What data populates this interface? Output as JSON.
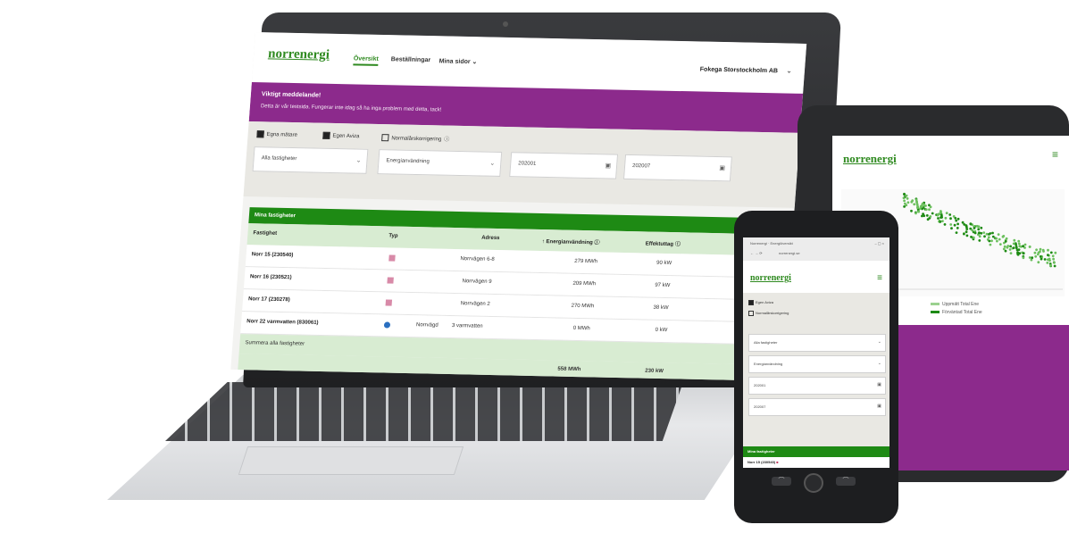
{
  "brand": {
    "logo": "norrenergi",
    "accent": "#1e8a14",
    "purple": "#8c2a8c"
  },
  "laptop": {
    "nav": {
      "items": [
        {
          "label": "Översikt",
          "active": true
        },
        {
          "label": "Beställningar",
          "active": false
        },
        {
          "label": "Mina sidor ⌄",
          "active": false
        }
      ],
      "org": "Fokega Storstockholm AB"
    },
    "banner": {
      "title": "Viktigt meddelande!",
      "text": "Detta är vår testsida. Fungerar inte idag så ha inga problem med detta, tack!"
    },
    "filters": {
      "checkbox_own_meter": "Egna mätare",
      "checkbox_own_fuel": "Egen Aviza",
      "checkbox_normal_year": "Normalårskorrigering",
      "select_properties": "Alla fastigheter",
      "select_metric": "Energianvändning",
      "date_from": "202001",
      "date_to": "202007"
    },
    "table": {
      "title": "Mina fastigheter",
      "columns": [
        "Fastighet",
        "Typ",
        "Adress",
        "Energianvändning",
        "Effektuttag"
      ],
      "rows": [
        {
          "name": "Norr 15 (230540)",
          "type": "building",
          "address": "Norrvägen 6-8",
          "energy": "279 MWh",
          "power": "90 kW"
        },
        {
          "name": "Norr 16 (230521)",
          "type": "building",
          "address": "Norrvägen 9",
          "energy": "209 MWh",
          "power": "97 kW"
        },
        {
          "name": "Norr 17 (230278)",
          "type": "building",
          "address": "Norrvägen 2",
          "energy": "270 MWh",
          "power": "38 kW"
        },
        {
          "name": "Norr 22 varmvatten (830061)",
          "type": "water",
          "address_prefix": "Norrvägd",
          "address": "3 varmvatten",
          "energy": "0 MWh",
          "power": "0 kW"
        }
      ],
      "summary_label": "Summera alla fastigheter",
      "total_energy": "558 MWh",
      "total_power": "230 kW"
    }
  },
  "tablet": {
    "legend": [
      "Uppmätt Total Ene",
      "Förväntad Total Ene"
    ]
  },
  "phone": {
    "browser": {
      "tab": "Norrenergi · Energiöversikt",
      "url": "norrenergi.se"
    },
    "filters": {
      "checkbox_own_fuel": "Egen Aviza",
      "checkbox_normal_year": "Normalårskorrigering",
      "select_properties": "Alla fastigheter",
      "select_metric": "Energianvändning",
      "date_from": "202001",
      "date_to": "202007"
    },
    "table_title": "Mina fastigheter",
    "first_row": "Norr 15 (230540)"
  }
}
